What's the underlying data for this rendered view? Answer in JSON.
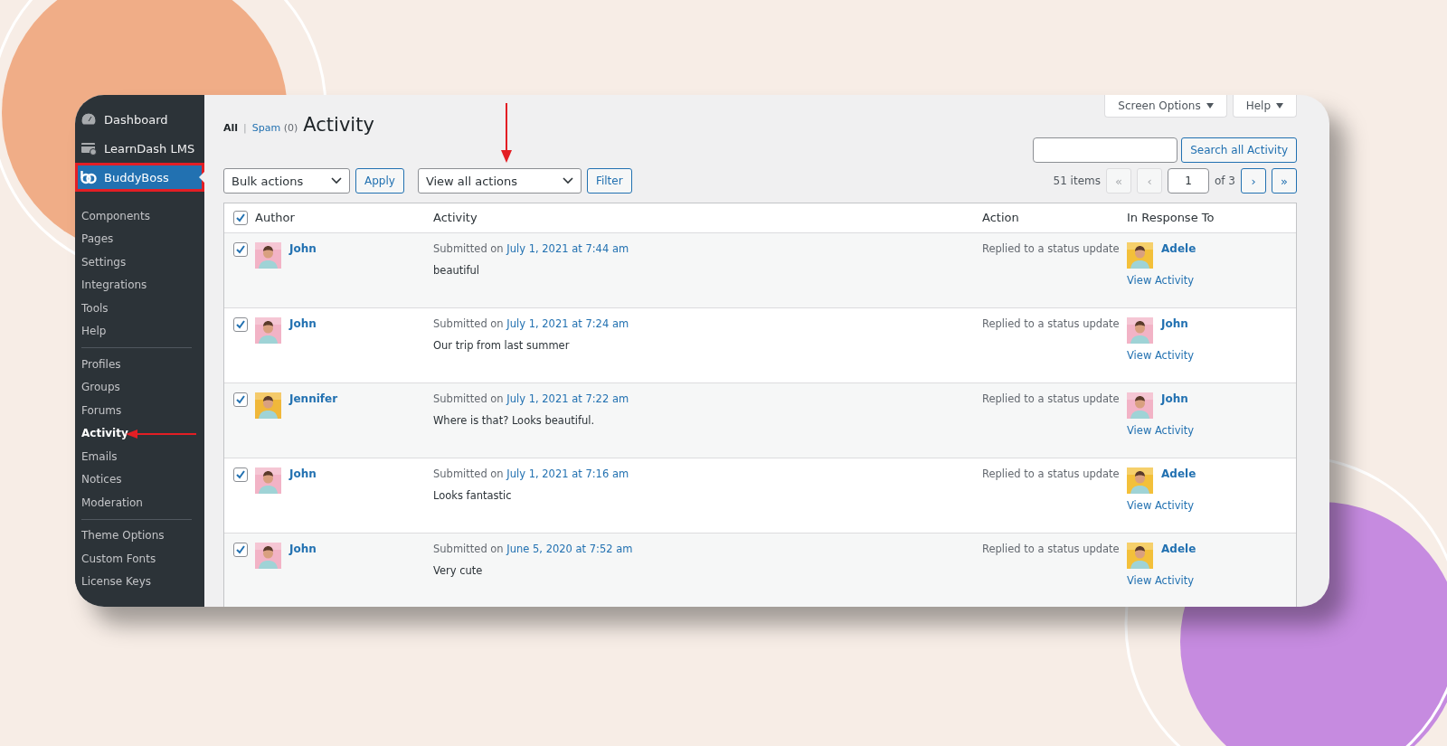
{
  "sidebar": {
    "items": [
      {
        "label": "Dashboard",
        "kind": "gauge",
        "selected": false,
        "annotated": false
      },
      {
        "label": "LearnDash LMS",
        "kind": "course",
        "selected": false,
        "annotated": false
      },
      {
        "label": "BuddyBoss",
        "kind": "logo",
        "selected": true,
        "annotated": true,
        "children": [
          {
            "kind": "link",
            "label": "Components",
            "selected": false,
            "annotated": false
          },
          {
            "kind": "link",
            "label": "Pages",
            "selected": false,
            "annotated": false
          },
          {
            "kind": "link",
            "label": "Settings",
            "selected": false,
            "annotated": false
          },
          {
            "kind": "link",
            "label": "Integrations",
            "selected": false,
            "annotated": false
          },
          {
            "kind": "link",
            "label": "Tools",
            "selected": false,
            "annotated": false
          },
          {
            "kind": "link",
            "label": "Help",
            "selected": false,
            "annotated": false
          },
          {
            "kind": "separator"
          },
          {
            "kind": "link",
            "label": "Profiles",
            "selected": false,
            "annotated": false
          },
          {
            "kind": "link",
            "label": "Groups",
            "selected": false,
            "annotated": false
          },
          {
            "kind": "link",
            "label": "Forums",
            "selected": false,
            "annotated": false
          },
          {
            "kind": "link",
            "label": "Activity",
            "selected": true,
            "annotated": true
          },
          {
            "kind": "link",
            "label": "Emails",
            "selected": false,
            "annotated": false
          },
          {
            "kind": "link",
            "label": "Notices",
            "selected": false,
            "annotated": false
          },
          {
            "kind": "link",
            "label": "Moderation",
            "selected": false,
            "annotated": false
          },
          {
            "kind": "separator"
          },
          {
            "kind": "link",
            "label": "Theme Options",
            "selected": false,
            "annotated": false
          },
          {
            "kind": "link",
            "label": "Custom Fonts",
            "selected": false,
            "annotated": false
          },
          {
            "kind": "link",
            "label": "License Keys",
            "selected": false,
            "annotated": false
          }
        ]
      }
    ]
  },
  "header_tabs": [
    {
      "label": "Screen Options"
    },
    {
      "label": "Help"
    }
  ],
  "views": [
    {
      "label": "All",
      "selected": true
    },
    {
      "kind": "separator",
      "label": "|"
    },
    {
      "label": "Spam",
      "count": "(0)",
      "selected": false
    }
  ],
  "title": "Activity",
  "search": {
    "button": "Search all Activity"
  },
  "bulk": {
    "select": "Bulk actions",
    "button": "Apply"
  },
  "filter": {
    "select": "View all actions",
    "button": "Filter",
    "annotated": true
  },
  "pagination": {
    "count": "51 items",
    "first": "«",
    "prev": "‹",
    "page": "1",
    "of": "of 3",
    "next": "›",
    "last": "»"
  },
  "table": {
    "select_all": true,
    "columns": [
      "Author",
      "Activity",
      "Action",
      "In Response To"
    ],
    "rows": [
      {
        "checked": true,
        "author": {
          "name": "John",
          "color": "#f2b3c6"
        },
        "submitted": "Submitted on",
        "date": "July 1, 2021 at 7:44 am",
        "text": "beautiful",
        "action": "Replied to a status update",
        "response": {
          "name": "Adele",
          "color": "#f3c03a"
        },
        "link": "View Activity"
      },
      {
        "checked": true,
        "author": {
          "name": "John",
          "color": "#f2b3c6"
        },
        "submitted": "Submitted on",
        "date": "July 1, 2021 at 7:24 am",
        "text": "Our trip from last summer",
        "action": "Replied to a status update",
        "response": {
          "name": "John",
          "color": "#f2b3c6"
        },
        "link": "View Activity"
      },
      {
        "checked": true,
        "author": {
          "name": "Jennifer",
          "color": "#f0b83a"
        },
        "submitted": "Submitted on",
        "date": "July 1, 2021 at 7:22 am",
        "text": "Where is that? Looks beautiful.",
        "action": "Replied to a status update",
        "response": {
          "name": "John",
          "color": "#f2b3c6"
        },
        "link": "View Activity"
      },
      {
        "checked": true,
        "author": {
          "name": "John",
          "color": "#f2b3c6"
        },
        "submitted": "Submitted on",
        "date": "July 1, 2021 at 7:16 am",
        "text": "Looks fantastic",
        "action": "Replied to a status update",
        "response": {
          "name": "Adele",
          "color": "#f3c03a"
        },
        "link": "View Activity"
      },
      {
        "checked": true,
        "author": {
          "name": "John",
          "color": "#f2b3c6"
        },
        "submitted": "Submitted on",
        "date": "June 5, 2020 at 7:52 am",
        "text": "Very cute",
        "action": "Replied to a status update",
        "response": {
          "name": "Adele",
          "color": "#f3c03a"
        },
        "link": "View Activity"
      }
    ]
  }
}
